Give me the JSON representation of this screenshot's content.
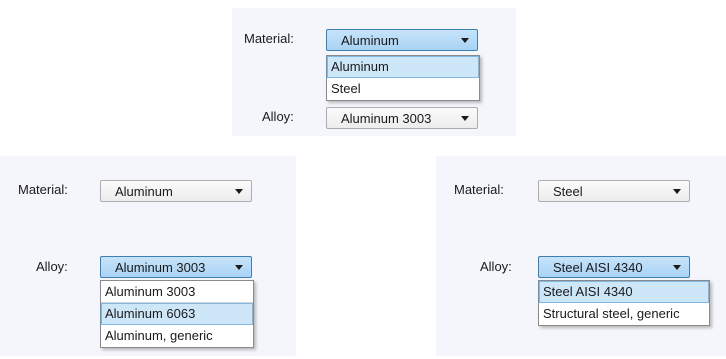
{
  "top": {
    "material_label": "Material:",
    "material_value": "Aluminum",
    "material_options": [
      "Aluminum",
      "Steel"
    ],
    "alloy_label": "Alloy:",
    "alloy_value": "Aluminum 3003"
  },
  "left": {
    "material_label": "Material:",
    "material_value": "Aluminum",
    "alloy_label": "Alloy:",
    "alloy_value": "Aluminum 3003",
    "alloy_options": [
      "Aluminum 3003",
      "Aluminum 6063",
      "Aluminum, generic"
    ]
  },
  "right": {
    "material_label": "Material:",
    "material_value": "Steel",
    "alloy_label": "Alloy:",
    "alloy_value": "Steel AISI 4340",
    "alloy_options": [
      "Steel AISI 4340",
      "Structural steel, generic"
    ]
  },
  "colors": {
    "panel_bg": "#f4f6fc",
    "active_combo": "#a9d3f5",
    "highlight_option": "#cde7f9"
  }
}
